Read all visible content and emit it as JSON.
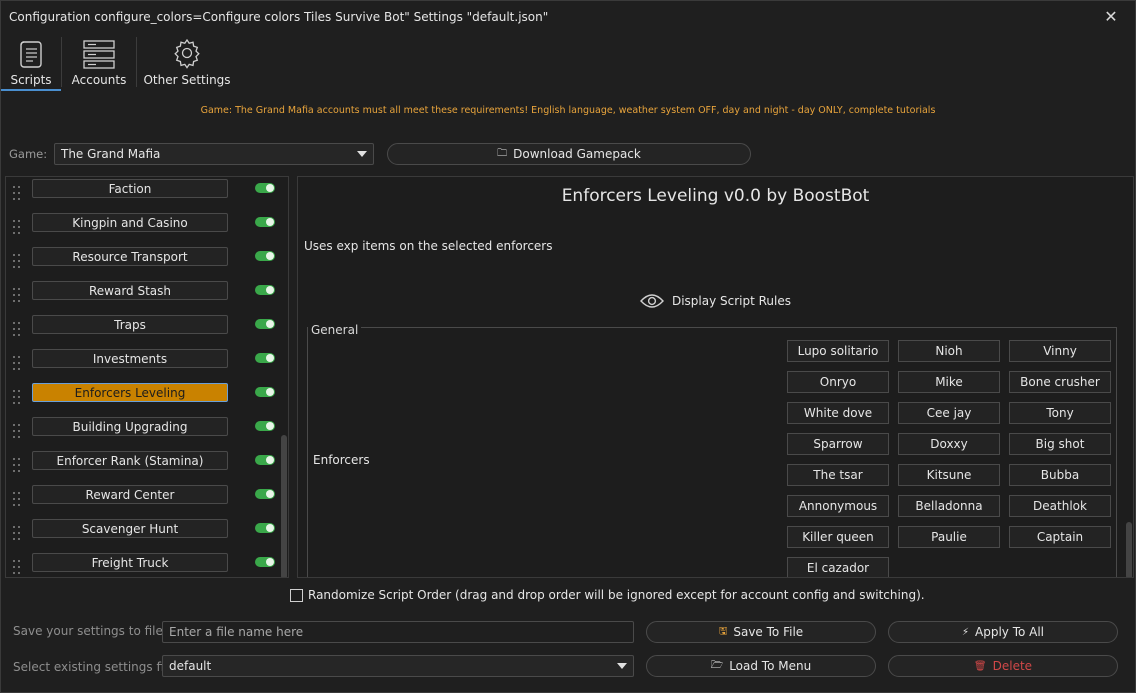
{
  "window": {
    "title": "Configuration configure_colors=Configure colors Tiles Survive Bot\" Settings \"default.json\"",
    "close_glyph": "✕"
  },
  "tabs": [
    {
      "label": "Scripts",
      "icon": "scroll-icon",
      "active": true
    },
    {
      "label": "Accounts",
      "icon": "server-icon",
      "active": false
    },
    {
      "label": "Other Settings",
      "icon": "gear-icon",
      "active": false
    }
  ],
  "notice": "Game: The Grand Mafia accounts must all meet these requirements! English language, weather system OFF, day and night - day ONLY, complete tutorials",
  "game": {
    "label": "Game:",
    "selected": "The Grand Mafia"
  },
  "download_button": {
    "label": "Download Gamepack",
    "icon": "folder-icon"
  },
  "scripts": [
    {
      "label": "Faction",
      "enabled": true,
      "selected": false
    },
    {
      "label": "Kingpin and Casino",
      "enabled": true,
      "selected": false
    },
    {
      "label": "Resource Transport",
      "enabled": true,
      "selected": false
    },
    {
      "label": "Reward Stash",
      "enabled": true,
      "selected": false
    },
    {
      "label": "Traps",
      "enabled": true,
      "selected": false
    },
    {
      "label": "Investments",
      "enabled": true,
      "selected": false
    },
    {
      "label": "Enforcers Leveling",
      "enabled": true,
      "selected": true
    },
    {
      "label": "Building Upgrading",
      "enabled": true,
      "selected": false
    },
    {
      "label": "Enforcer Rank (Stamina)",
      "enabled": true,
      "selected": false
    },
    {
      "label": "Reward Center",
      "enabled": true,
      "selected": false
    },
    {
      "label": "Scavenger Hunt",
      "enabled": true,
      "selected": false
    },
    {
      "label": "Freight Truck",
      "enabled": true,
      "selected": false
    }
  ],
  "script_panel": {
    "title": "Enforcers Leveling v0.0 by BoostBot",
    "description": "Uses exp items on the selected enforcers",
    "rules_label": "Display Script Rules",
    "group_label": "General",
    "enforcers_label": "Enforcers",
    "enforcers": [
      "Lupo solitario",
      "Nioh",
      "Vinny",
      "Onryo",
      "Mike",
      "Bone crusher",
      "White dove",
      "Cee jay",
      "Tony",
      "Sparrow",
      "Doxxy",
      "Big shot",
      "The tsar",
      "Kitsune",
      "Bubba",
      "Annonymous",
      "Belladonna",
      "Deathlok",
      "Killer queen",
      "Paulie",
      "Captain",
      "El cazador"
    ]
  },
  "randomize": {
    "label": "Randomize Script Order (drag and drop order will be ignored except for account config and switching).",
    "checked": false
  },
  "save_row": {
    "label": "Save your settings to file",
    "placeholder": "Enter a file name here",
    "value": ""
  },
  "load_row": {
    "label": "Select existing settings file",
    "selected": "default"
  },
  "buttons": {
    "save": {
      "label": "Save To File",
      "icon": "floppy-icon"
    },
    "apply": {
      "label": "Apply To All",
      "icon": "lightning-icon"
    },
    "load": {
      "label": "Load To Menu",
      "icon": "folder-open-icon"
    },
    "delete": {
      "label": "Delete",
      "icon": "trash-icon",
      "color": "#d04848"
    }
  },
  "colors": {
    "accent": "#4a8fd0",
    "selected_script": "#c98200",
    "toggle_on": "#3aa84a",
    "notice": "#e8a43c"
  }
}
